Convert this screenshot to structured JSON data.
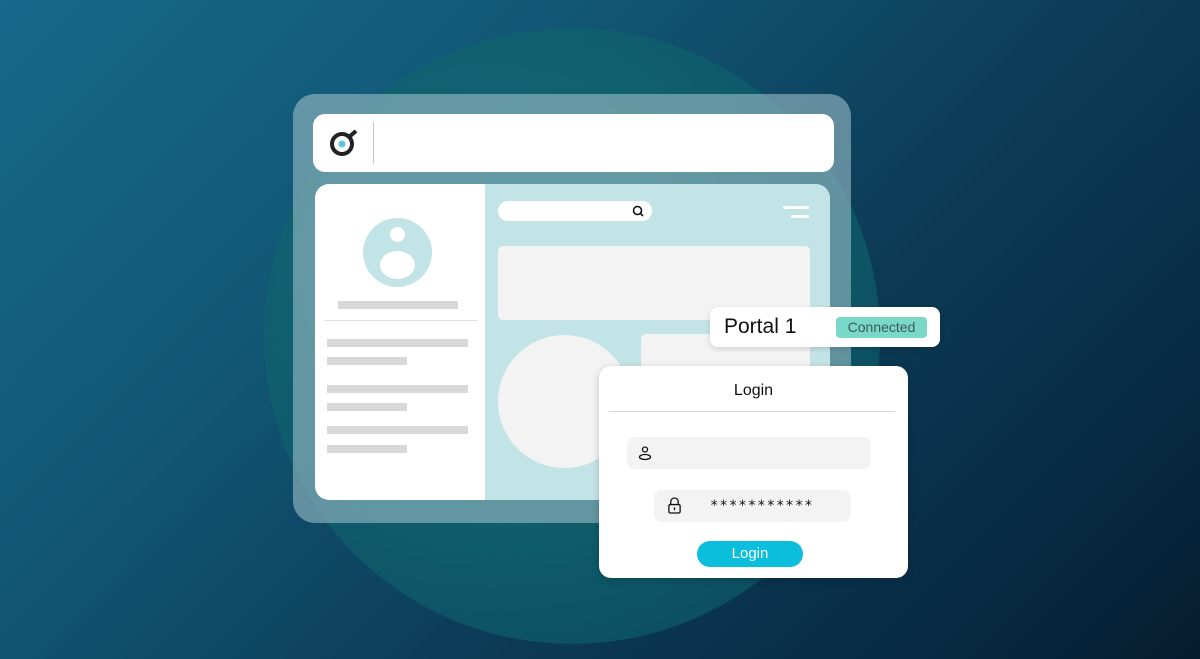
{
  "colors": {
    "accent": "#0bbfdc",
    "connected_badge": "#7ad8c8",
    "page_tint": "#c3e4e6"
  },
  "browser": {
    "logo_icon": "brand-logo-icon",
    "address_value": ""
  },
  "page": {
    "search": {
      "placeholder": "",
      "icon": "search-icon"
    },
    "menu_icon": "menu-icon"
  },
  "portal": {
    "name": "Portal 1",
    "status": "Connected"
  },
  "login": {
    "title": "Login",
    "username": {
      "value": "",
      "icon": "user-icon"
    },
    "password": {
      "value": "***********",
      "icon": "lock-icon"
    },
    "submit_label": "Login"
  }
}
